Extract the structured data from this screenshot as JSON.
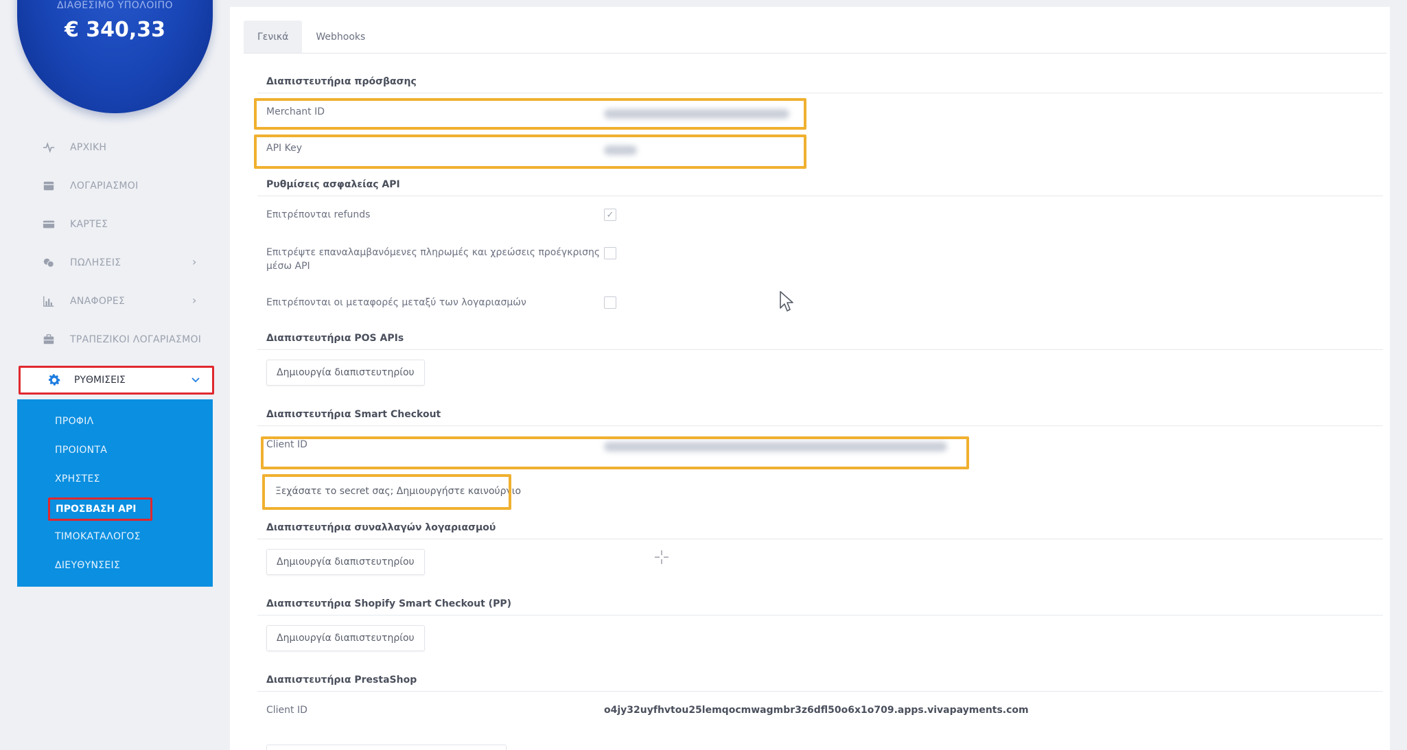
{
  "balance": {
    "label": "ΔΙΑΘΕΣΙΜΟ ΥΠΟΛΟΙΠΟ",
    "value": "€ 340,33"
  },
  "sidebar": {
    "items": [
      {
        "label": "ΑΡΧΙΚΗ",
        "icon": "activity-icon"
      },
      {
        "label": "ΛΟΓΑΡΙΑΣΜΟΙ",
        "icon": "wallet-icon"
      },
      {
        "label": "ΚΑΡΤΕΣ",
        "icon": "card-icon"
      },
      {
        "label": "ΠΩΛΗΣΕΙΣ",
        "icon": "coins-icon"
      },
      {
        "label": "ΑΝΑΦΟΡΕΣ",
        "icon": "bar-chart-icon"
      },
      {
        "label": "ΤΡΑΠΕΖΙΚΟΙ ΛΟΓΑΡΙΑΣΜΟΙ",
        "icon": "bank-icon"
      }
    ],
    "settings_label": "ΡΥΘΜΙΣΕΙΣ",
    "submenu": [
      "ΠΡΟΦΙΛ",
      "ΠΡΟΙΟΝΤΑ",
      "ΧΡΗΣΤΕΣ",
      "ΠΡΟΣΒΑΣΗ API",
      "ΤΙΜΟΚΑΤΑΛΟΓΟΣ",
      "ΔΙΕΥΘΥΝΣΕΙΣ"
    ]
  },
  "tabs": [
    "Γενικά",
    "Webhooks"
  ],
  "sections": {
    "access": {
      "title": "Διαπιστευτήρια πρόσβασης",
      "merchant_id_label": "Merchant ID",
      "api_key_label": "API Key"
    },
    "security": {
      "title": "Ρυθμίσεις ασφαλείας API",
      "refunds_label": "Επιτρέπονται refunds",
      "recurring_label_1": "Επιτρέψτε επαναλαμβανόμενες πληρωμές και χρεώσεις προέγκρισης",
      "recurring_label_2": "μέσω API",
      "transfers_label": "Επιτρέπονται οι μεταφορές μεταξύ των λογαριασμών"
    },
    "pos": {
      "title": "Διαπιστευτήρια POS APIs",
      "button": "Δημιουργία διαπιστευτηρίου"
    },
    "smart_checkout": {
      "title": "Διαπιστευτήρια Smart Checkout",
      "client_id_label": "Client ID",
      "secret_button": "Ξεχάσατε το secret σας; Δημιουργήστε καινούργιο"
    },
    "account_tx": {
      "title": "Διαπιστευτήρια συναλλαγών λογαριασμού",
      "button": "Δημιουργία διαπιστευτηρίου"
    },
    "shopify": {
      "title": "Διαπιστευτήρια Shopify Smart Checkout (PP)",
      "button": "Δημιουργία διαπιστευτηρίου"
    },
    "prestashop": {
      "title": "Διαπιστευτήρια PrestaShop",
      "client_id_label": "Client ID",
      "client_id_value": "o4jy32uyfhvtou25lemqocmwagmbr3z6dfl50o6x1o709.apps.vivapayments.com"
    }
  },
  "colors": {
    "accent_blue": "#0b8fe0",
    "highlight_orange": "#f0b030",
    "highlight_red": "#e0282e"
  }
}
